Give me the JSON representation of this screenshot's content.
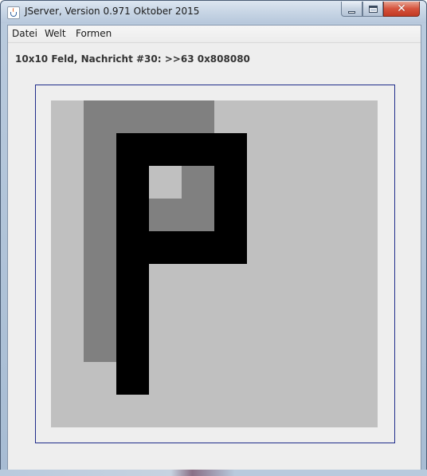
{
  "window": {
    "title": "JServer, Version 0.971 Oktober 2015",
    "app_icon": "java-cup-icon"
  },
  "menu": {
    "items": [
      {
        "label": "Datei"
      },
      {
        "label": "Welt"
      },
      {
        "label": "Formen"
      }
    ]
  },
  "status": {
    "text": "10x10 Feld, Nachricht #30: >>63 0x808080"
  },
  "board": {
    "rows": 10,
    "cols": 10,
    "colors": {
      "L": "#c0c0c0",
      "G": "#808080",
      "B": "#000000"
    },
    "grid": [
      "LGGGGLLLLL",
      "LGBBBBLLLL",
      "LGBLGBLLLL",
      "LGBGGBLLLL",
      "LGBBBBLLLL",
      "LGBLLLLLLL",
      "LGBLLLLLLL",
      "LGBLLLLLLL",
      "LLBLLLLLLL",
      "LLLLLLLLLL"
    ]
  }
}
